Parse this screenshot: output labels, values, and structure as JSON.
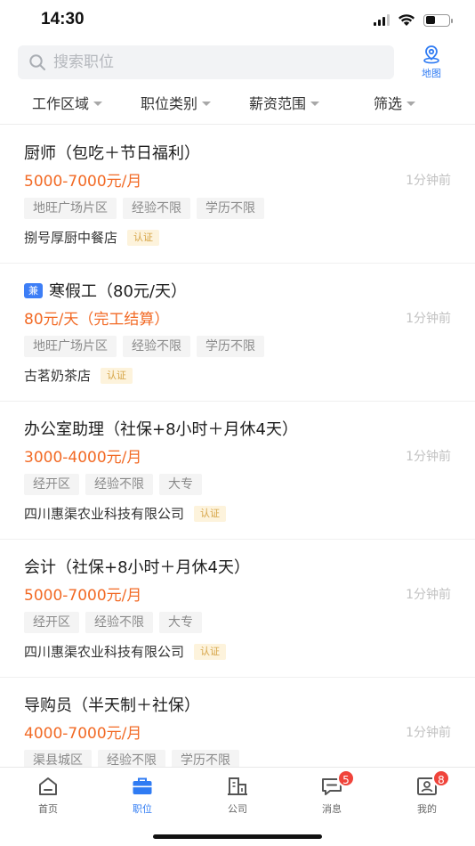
{
  "status_bar": {
    "time": "14:30",
    "battery_level": 0.4
  },
  "search": {
    "placeholder": "搜索职位",
    "value": ""
  },
  "map_button": {
    "label": "地图",
    "icon": "map-pin-icon"
  },
  "filters": [
    {
      "label": "工作区域"
    },
    {
      "label": "职位类别"
    },
    {
      "label": "薪资范围"
    },
    {
      "label": "筛选"
    }
  ],
  "jobs": [
    {
      "title": "厨师（包吃＋节日福利）",
      "part_time_badge": "",
      "salary": "5000-7000元/月",
      "posted": "1分钟前",
      "tags": [
        "地旺广场片区",
        "经验不限",
        "学历不限"
      ],
      "company": "捌号厚厨中餐店",
      "verified": "认证"
    },
    {
      "title": "寒假工（80元/天）",
      "part_time_badge": "兼",
      "salary": "80元/天（完工结算）",
      "posted": "1分钟前",
      "tags": [
        "地旺广场片区",
        "经验不限",
        "学历不限"
      ],
      "company": "古茗奶茶店",
      "verified": "认证"
    },
    {
      "title": "办公室助理（社保+8小时＋月休4天）",
      "part_time_badge": "",
      "salary": "3000-4000元/月",
      "posted": "1分钟前",
      "tags": [
        "经开区",
        "经验不限",
        "大专"
      ],
      "company": "四川惠渠农业科技有限公司",
      "verified": "认证"
    },
    {
      "title": "会计（社保+8小时＋月休4天）",
      "part_time_badge": "",
      "salary": "5000-7000元/月",
      "posted": "1分钟前",
      "tags": [
        "经开区",
        "经验不限",
        "大专"
      ],
      "company": "四川惠渠农业科技有限公司",
      "verified": "认证"
    },
    {
      "title": "导购员（半天制＋社保）",
      "part_time_badge": "",
      "salary": "4000-7000元/月",
      "posted": "1分钟前",
      "tags": [
        "渠县城区",
        "经验不限",
        "学历不限"
      ],
      "company": "",
      "verified": ""
    }
  ],
  "tab_bar": {
    "tabs": [
      {
        "label": "首页",
        "icon": "home-icon",
        "active": false,
        "badge": ""
      },
      {
        "label": "职位",
        "icon": "briefcase-icon",
        "active": true,
        "badge": ""
      },
      {
        "label": "公司",
        "icon": "building-icon",
        "active": false,
        "badge": ""
      },
      {
        "label": "消息",
        "icon": "message-icon",
        "active": false,
        "badge": "5"
      },
      {
        "label": "我的",
        "icon": "profile-card-icon",
        "active": false,
        "badge": "8"
      }
    ]
  },
  "colors": {
    "accent": "#2f7bf3",
    "salary": "#f26a25",
    "badge": "#f0443b",
    "verified_bg": "#fdf3dc",
    "verified_text": "#d6a446"
  }
}
